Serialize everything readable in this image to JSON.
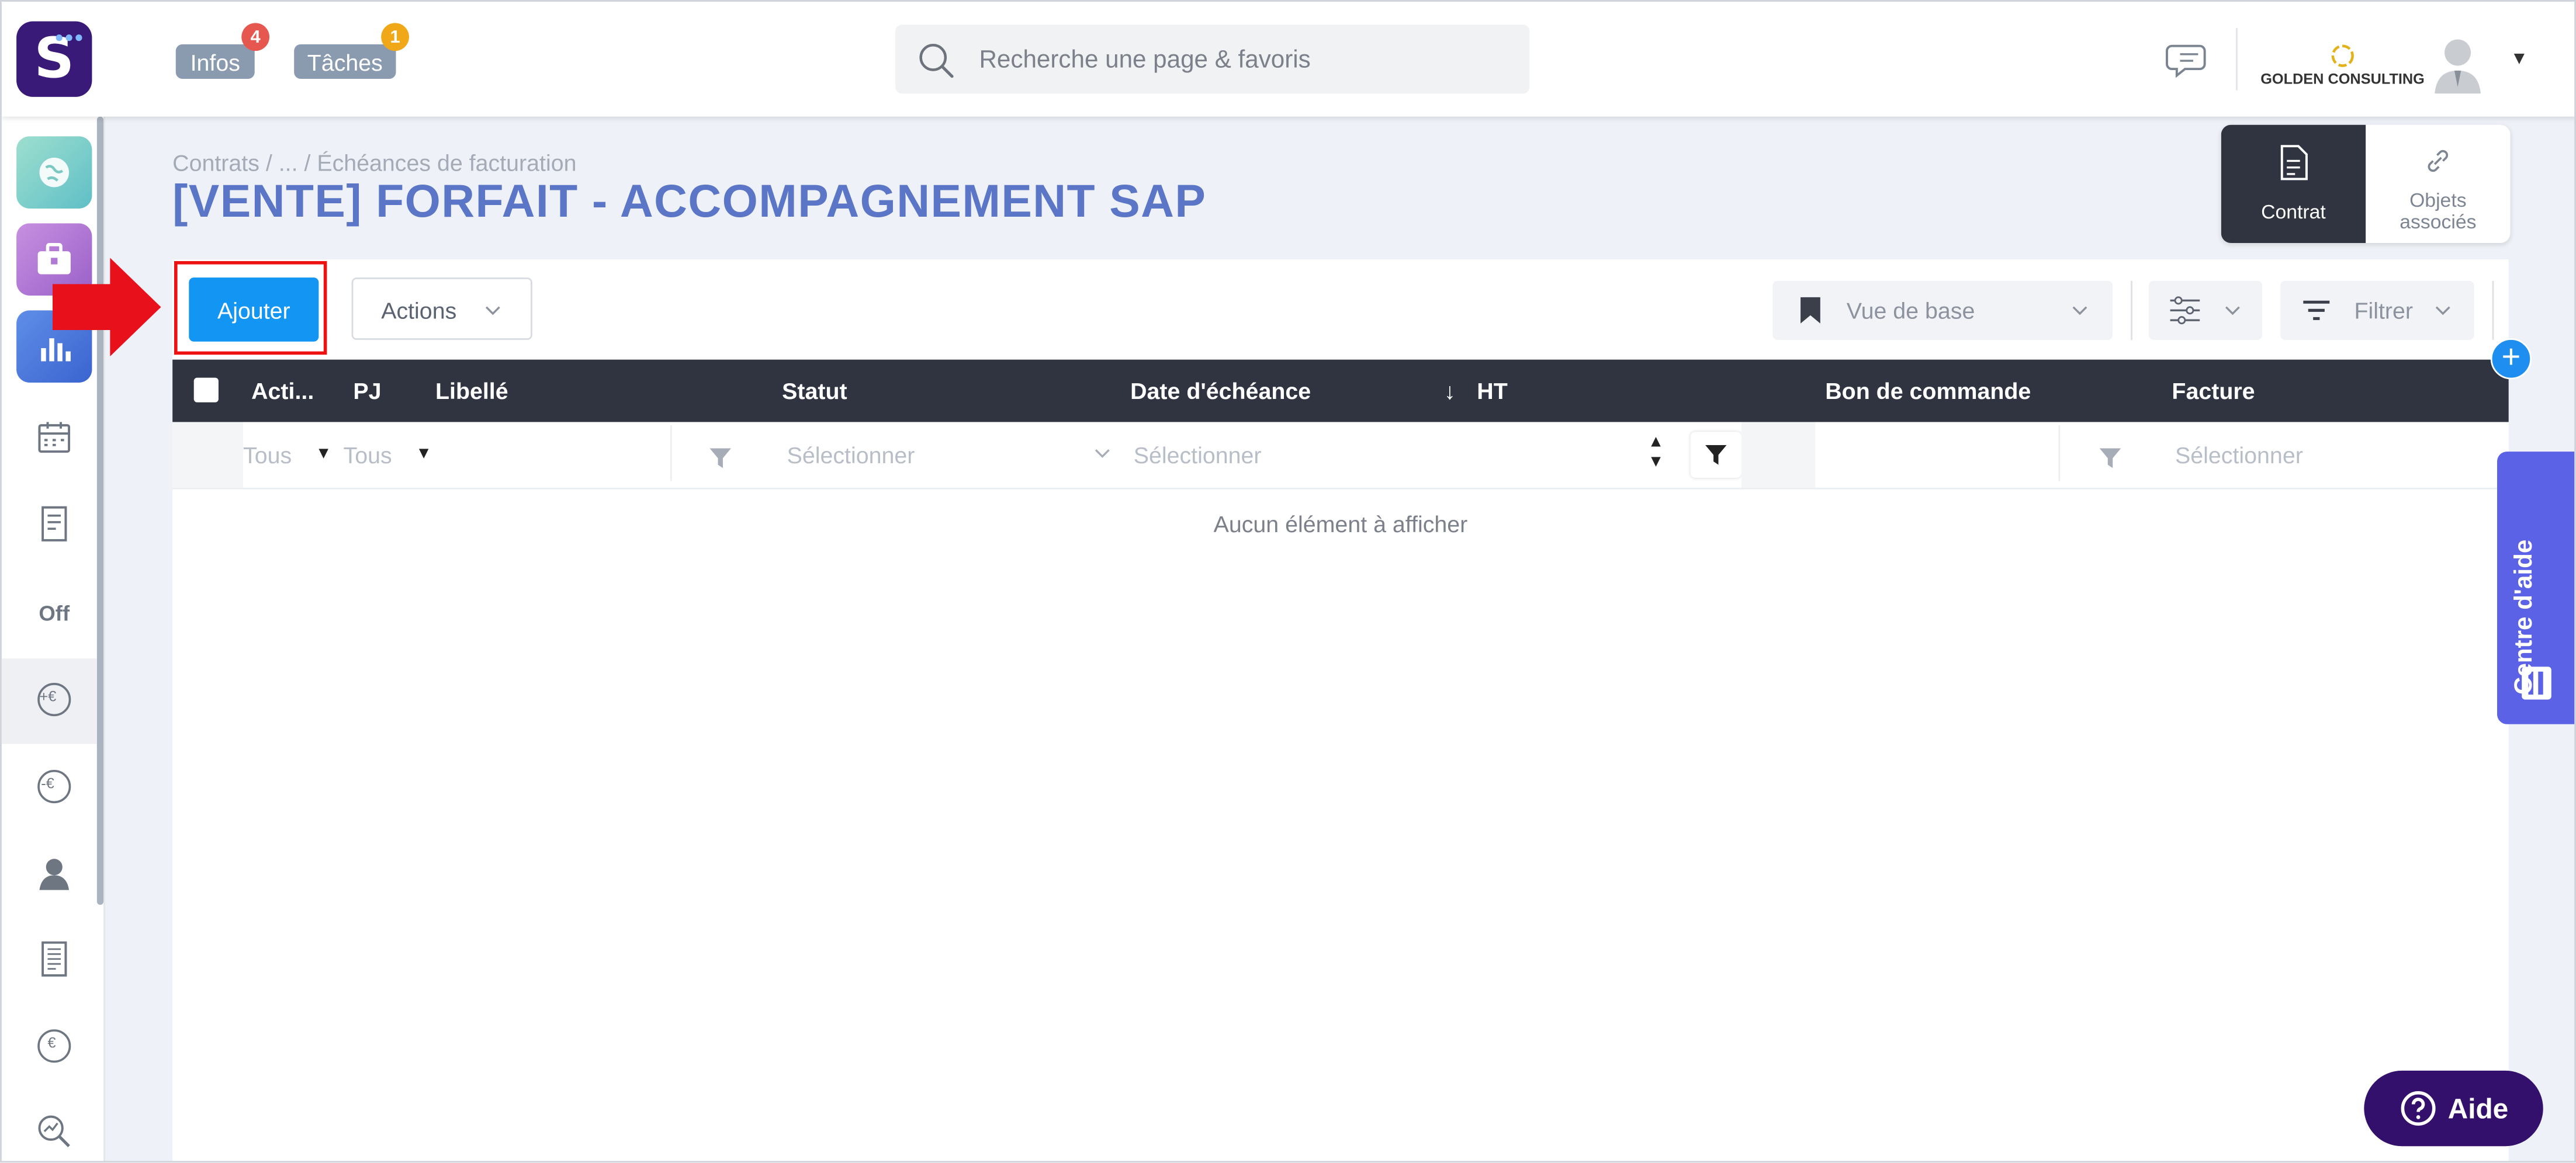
{
  "header": {
    "logo_letter": "S",
    "infos_label": "Infos",
    "infos_count": "4",
    "taches_label": "Tâches",
    "taches_count": "1",
    "search_placeholder": "Recherche une page & favoris",
    "company_name": "GOLDEN CONSULTING",
    "colors": {
      "brand": "#3a1a78",
      "infos_badge": "#e5574f",
      "taches_badge": "#f0a819"
    }
  },
  "sidebar": {
    "items": [
      {
        "icon": "globe-icon"
      },
      {
        "icon": "briefcase-icon"
      },
      {
        "icon": "bar-chart-icon"
      },
      {
        "icon": "calendar-icon"
      },
      {
        "icon": "receipt-icon"
      },
      {
        "icon": "off-icon",
        "text": "Off"
      },
      {
        "icon": "euro-plus-icon",
        "text": "+€"
      },
      {
        "icon": "euro-minus-icon",
        "text": "-€"
      },
      {
        "icon": "user-icon"
      },
      {
        "icon": "invoice-icon"
      },
      {
        "icon": "coin-icon",
        "text": "€"
      },
      {
        "icon": "search-chart-icon"
      }
    ]
  },
  "page": {
    "breadcrumb": "Contrats  /  ...  /  Échéances de facturation",
    "title": "[VENTE] FORFAIT - ACCOMPAGNEMENT SAP"
  },
  "tabs": [
    {
      "label": "Contrat",
      "icon": "document-icon"
    },
    {
      "label": "Objets associés",
      "icon": "link-icon"
    }
  ],
  "toolbar": {
    "add_label": "Ajouter",
    "actions_label": "Actions",
    "view_label": "Vue de base",
    "filter_label": "Filtrer"
  },
  "table": {
    "columns": [
      "Acti...",
      "PJ",
      "Libellé",
      "Statut",
      "Date d'échéance",
      "HT",
      "Bon de commande",
      "Facture"
    ],
    "sort_indicator": "↓",
    "filters": {
      "actions": "Tous",
      "pj": "Tous",
      "statut": "Sélectionner",
      "date": "Sélectionner",
      "facture": "Sélectionner"
    },
    "empty_text": "Aucun élément à afficher"
  },
  "help": {
    "side_tab_label": "Centre d'aide",
    "aide_button": "Aide"
  }
}
